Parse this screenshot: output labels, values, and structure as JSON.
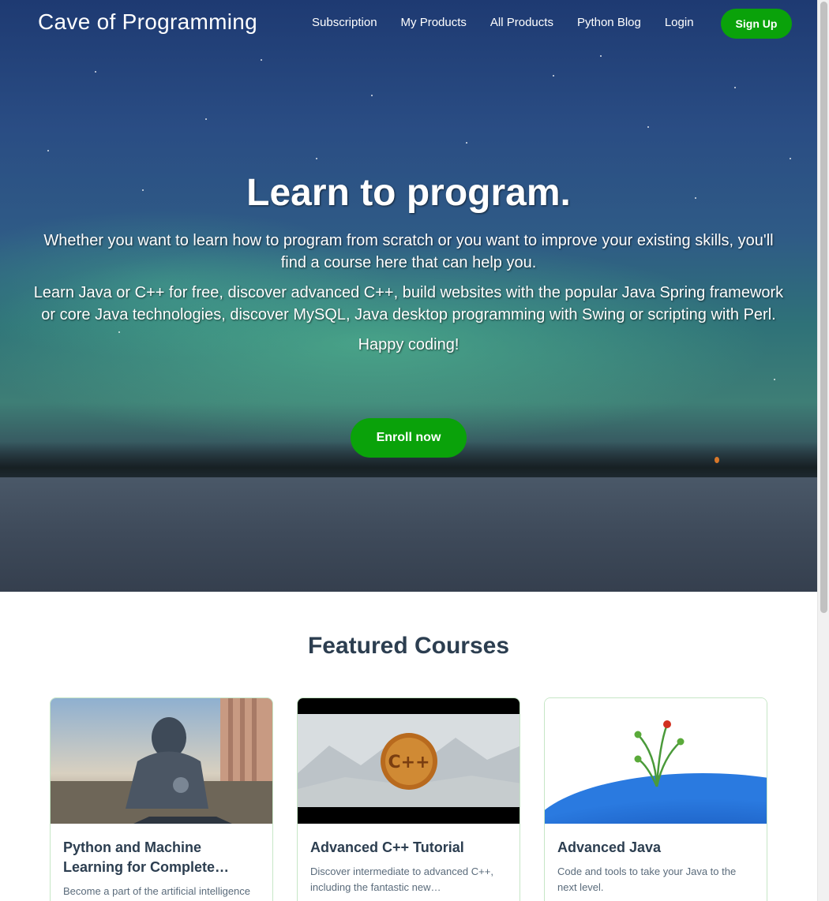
{
  "nav": {
    "brand": "Cave of Programming",
    "links": [
      "Subscription",
      "My Products",
      "All Products",
      "Python Blog",
      "Login"
    ],
    "signup": "Sign Up"
  },
  "hero": {
    "title": "Learn to program.",
    "paragraph1": "Whether you want to learn how to program from scratch or you want to improve your existing skills, you'll find a course here that can help you.",
    "paragraph2": "Learn Java or C++ for free, discover advanced C++, build websites with the popular Java Spring framework or core Java technologies, discover MySQL, Java desktop programming with Swing or scripting with Perl.",
    "paragraph3": "Happy coding!",
    "cta": "Enroll now"
  },
  "featured": {
    "heading": "Featured Courses",
    "courses": [
      {
        "title": "Python and Machine Learning for Complete…",
        "description": "Become a part of the artificial intelligence revolution…"
      },
      {
        "title": "Advanced C++ Tutorial",
        "description": "Discover intermediate to advanced C++, including the fantastic new…"
      },
      {
        "title": "Advanced Java",
        "description": "Code and tools to take your Java to the next level."
      }
    ]
  },
  "colors": {
    "accent": "#0aa20a",
    "heading": "#2c3e50"
  }
}
